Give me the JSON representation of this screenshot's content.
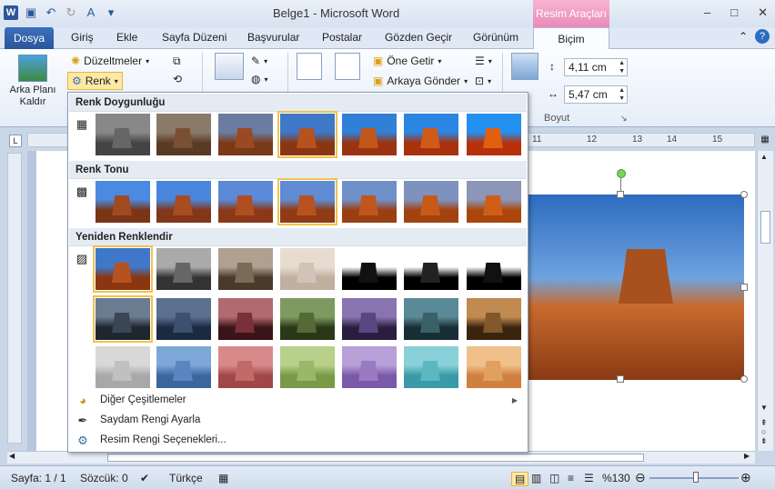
{
  "window": {
    "title": "Belge1 - Microsoft Word",
    "context_tab_group": "Resim Araçları"
  },
  "tabs": [
    "Dosya",
    "Giriş",
    "Ekle",
    "Sayfa Düzeni",
    "Başvurular",
    "Postalar",
    "Gözden Geçir",
    "Görünüm",
    "Biçim"
  ],
  "ribbon": {
    "arka_plani": "Arka Planı\nKaldır",
    "duzeltmeler": "Düzeltmeler",
    "renk": "Renk",
    "one_getir": "Öne Getir",
    "arkaya_gonder": "Arkaya Gönder",
    "height_value": "4,11 cm",
    "width_value": "5,47 cm",
    "boyut_label": "Boyut"
  },
  "color_menu": {
    "section_saturation": "Renk Doygunluğu",
    "section_tone": "Renk Tonu",
    "section_recolor": "Yeniden Renklendir",
    "more_variations": "Diğer Çeşitlemeler",
    "set_transparent": "Saydam Rengi Ayarla",
    "picture_color_options": "Resim Rengi Seçenekleri...",
    "selected_saturation_index": 3,
    "selected_tone_index": 3,
    "selected_recolor_index": 0
  },
  "status": {
    "page": "Sayfa: 1 / 1",
    "words": "Sözcük: 0",
    "language": "Türkçe",
    "zoom": "%130"
  },
  "ruler_numbers": [
    "11",
    "12",
    "13",
    "14",
    "15"
  ]
}
